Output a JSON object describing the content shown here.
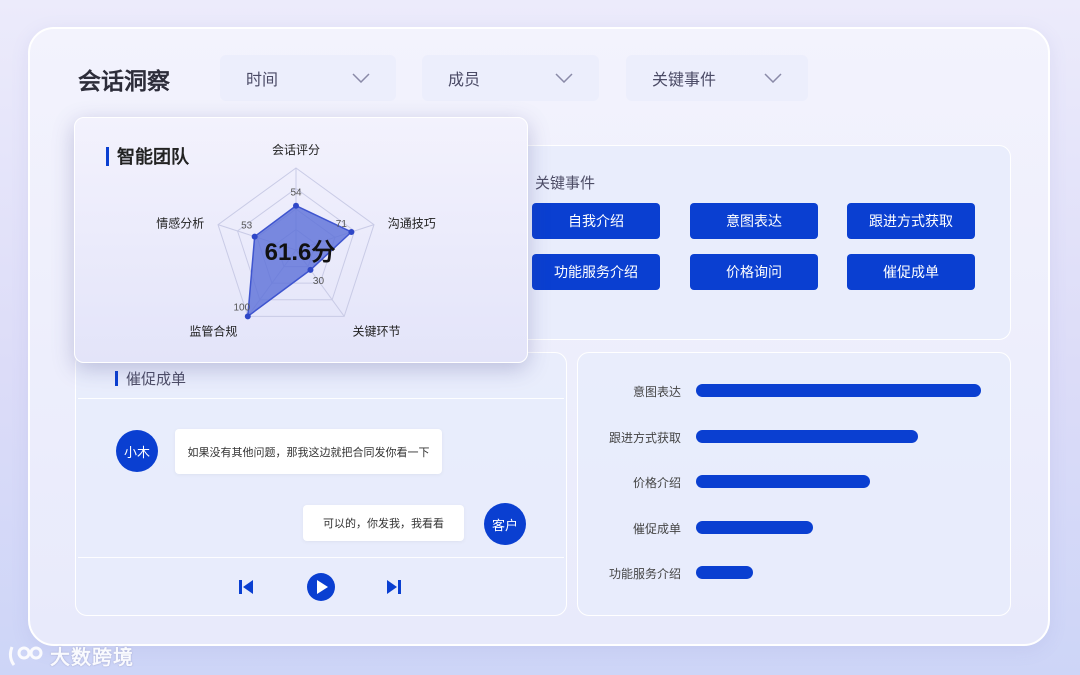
{
  "header": {
    "title": "会话洞察"
  },
  "filters": [
    {
      "label": "时间"
    },
    {
      "label": "成员"
    },
    {
      "label": "关键事件"
    }
  ],
  "radar": {
    "title": "智能团队",
    "score_label": "61.6分",
    "chart_data": {
      "type": "radar",
      "axes": [
        "会话评分",
        "沟通技巧",
        "关键环节",
        "监管合规",
        "情感分析"
      ],
      "values": [
        54,
        71,
        30,
        100,
        53
      ],
      "max": 100
    }
  },
  "events": {
    "title": "关键事件",
    "tags": [
      "自我介绍",
      "意图表达",
      "跟进方式获取",
      "功能服务介绍",
      "价格询问",
      "催促成单"
    ]
  },
  "conversation": {
    "title": "催促成单",
    "messages": [
      {
        "speaker": "小木",
        "text": "如果没有其他问题，那我这边就把合同发你看一下"
      },
      {
        "speaker": "客户",
        "text": "可以的，你发我，我看看"
      }
    ],
    "controls": {
      "prev_icon": "skip-previous-icon",
      "play_icon": "play-icon",
      "next_icon": "skip-next-icon"
    }
  },
  "ranking": {
    "chart_data": {
      "type": "bar",
      "orientation": "horizontal",
      "categories": [
        "意图表达",
        "跟进方式获取",
        "价格介绍",
        "催促成单",
        "功能服务介绍"
      ],
      "values": [
        100,
        78,
        61,
        41,
        20
      ],
      "xlim": [
        0,
        100
      ]
    }
  },
  "watermark": {
    "text": "大数跨境"
  },
  "colors": {
    "accent": "#0a3fd1",
    "radar_fill": "#5b6fd8"
  }
}
